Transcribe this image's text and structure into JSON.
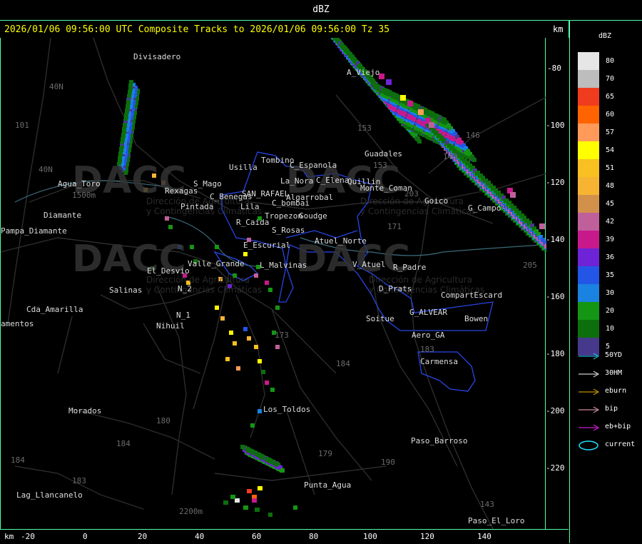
{
  "title": "dBZ",
  "header": {
    "text": "2026/01/06 09:56:00 UTC Composite Tracks to 2026/01/06 09:56:00 Tz 35",
    "unit": "km"
  },
  "x_axis": {
    "unit": "km",
    "ticks": [
      "-20",
      "0",
      "20",
      "40",
      "60",
      "80",
      "100",
      "120",
      "140"
    ]
  },
  "y_axis": {
    "ticks": [
      "-80",
      "-100",
      "-120",
      "-140",
      "-160",
      "-180",
      "-200",
      "-220"
    ]
  },
  "legend": {
    "title": "dBZ",
    "scale": [
      {
        "value": "80",
        "color": "#e6e6e6"
      },
      {
        "value": "70",
        "color": "#bdbdbd"
      },
      {
        "value": "65",
        "color": "#f03c1e"
      },
      {
        "value": "60",
        "color": "#ff6400"
      },
      {
        "value": "57",
        "color": "#ff9a5a"
      },
      {
        "value": "54",
        "color": "#ffff00"
      },
      {
        "value": "51",
        "color": "#f8c020"
      },
      {
        "value": "48",
        "color": "#f6b432"
      },
      {
        "value": "45",
        "color": "#d2914b"
      },
      {
        "value": "42",
        "color": "#c0609a"
      },
      {
        "value": "39",
        "color": "#c8198c"
      },
      {
        "value": "36",
        "color": "#6e23d6"
      },
      {
        "value": "35",
        "color": "#2356e6"
      },
      {
        "value": "30",
        "color": "#1a82e0"
      },
      {
        "value": "20",
        "color": "#149614"
      },
      {
        "value": "10",
        "color": "#0c6e0c"
      },
      {
        "value": "5",
        "color": "#46398c"
      }
    ],
    "tracks": [
      {
        "label": "50YD",
        "color": "#20e0ff"
      },
      {
        "label": "30HM",
        "color": "#ffffff"
      },
      {
        "label": "eburn",
        "color": "#f0b400"
      },
      {
        "label": "bip",
        "color": "#ffb0c0"
      },
      {
        "label": "eb+bip",
        "color": "#ff20ff"
      },
      {
        "label": "current",
        "color": "#20e0ff"
      }
    ]
  },
  "place_labels": [
    "Divisadero",
    "40N",
    "101",
    "40N",
    "Agua_Toro",
    "Pampa_Diamante",
    "Diamante",
    "Cda_Amarilla",
    "amentos",
    "Salinas",
    "N_2",
    "N_1",
    "Nihuil",
    "Tombino",
    "Usilla",
    "C_Espanola",
    "La_Nora",
    "C_Elena",
    "C_bombai",
    "Algarrobal",
    "SAN_RAFAEL",
    "C_Benegas",
    "Pintada",
    "Rexagas",
    "S_Mago",
    "Lila",
    "Tropezon",
    "Goudge",
    "R_Caida",
    "S_Rosas",
    "Atuel_Norte",
    "E_Escurial",
    "Valle_Grande",
    "L_Malvinas",
    "El_Desvio",
    "Quillin",
    "Guadales",
    "Monte_Coman",
    "Goico",
    "G_Campo",
    "A_Viejo",
    "146",
    "148",
    "153",
    "203",
    "171",
    "V_Atuel",
    "R_Padre",
    "D_Prats",
    "CompartEscard",
    "G_ALVEAR",
    "Soitue",
    "Bowen",
    "Aero_GA",
    "Carmensa",
    "183",
    "173",
    "184",
    "Los_Toldos",
    "Morados",
    "180",
    "184",
    "179",
    "190",
    "184",
    "183",
    "Lag_Llancanelo",
    "2200m",
    "Punta_Agua",
    "Paso_Barroso",
    "Paso_El_Loro",
    "143",
    "205",
    "153",
    "1500m"
  ],
  "watermark": {
    "logo": "DACC",
    "line1": "Dirección de Agricultura",
    "line2": "y Contingencias Climáticas"
  }
}
